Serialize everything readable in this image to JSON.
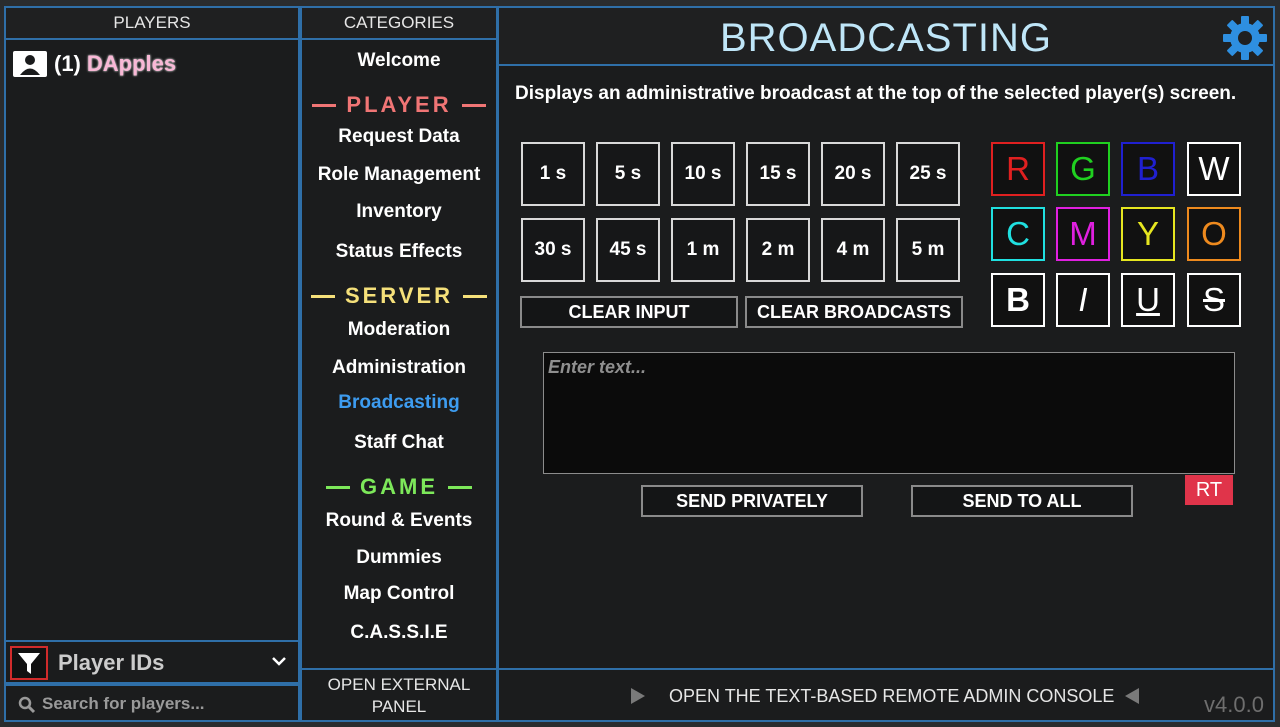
{
  "players": {
    "header": "PLAYERS",
    "list": [
      {
        "number": "(1)",
        "name": "DApples"
      }
    ],
    "filter_label": "Player IDs",
    "search_placeholder": "Search for players..."
  },
  "categories": {
    "header": "CATEGORIES",
    "welcome": "Welcome",
    "section_player": "PLAYER",
    "player_items": [
      "Request Data",
      "Role Management",
      "Inventory",
      "Status Effects"
    ],
    "section_server": "SERVER",
    "server_items": [
      "Moderation",
      "Administration",
      "Broadcasting",
      "Staff Chat"
    ],
    "section_game": "GAME",
    "game_items": [
      "Round & Events",
      "Dummies",
      "Map Control",
      "C.A.S.S.I.E"
    ],
    "active": "Broadcasting",
    "external_panel": "OPEN EXTERNAL PANEL",
    "colors": {
      "player": "#f07575",
      "server": "#f5e07a",
      "game": "#7de85a"
    }
  },
  "main": {
    "title": "BROADCASTING",
    "description": "Displays an administrative broadcast at the top of the selected player(s) screen.",
    "durations": [
      "1 s",
      "5 s",
      "10 s",
      "15 s",
      "20 s",
      "25 s",
      "30 s",
      "45 s",
      "1 m",
      "2 m",
      "4 m",
      "5 m"
    ],
    "clear_input": "CLEAR INPUT",
    "clear_broadcasts": "CLEAR BROADCASTS",
    "color_buttons": [
      {
        "label": "R",
        "color": "#e02020"
      },
      {
        "label": "G",
        "color": "#20d020"
      },
      {
        "label": "B",
        "color": "#2020d0"
      },
      {
        "label": "W",
        "color": "#ffffff"
      },
      {
        "label": "C",
        "color": "#20e0e0"
      },
      {
        "label": "M",
        "color": "#e020e0"
      },
      {
        "label": "Y",
        "color": "#e6e620"
      },
      {
        "label": "O",
        "color": "#ee8a1e"
      }
    ],
    "format_buttons": [
      "B",
      "I",
      "U",
      "S"
    ],
    "text_placeholder": "Enter text...",
    "send_private": "SEND PRIVATELY",
    "send_all": "SEND TO ALL",
    "rt_label": "RT"
  },
  "console": {
    "label": "OPEN THE TEXT-BASED REMOTE ADMIN CONSOLE"
  },
  "version": "v4.0.0"
}
